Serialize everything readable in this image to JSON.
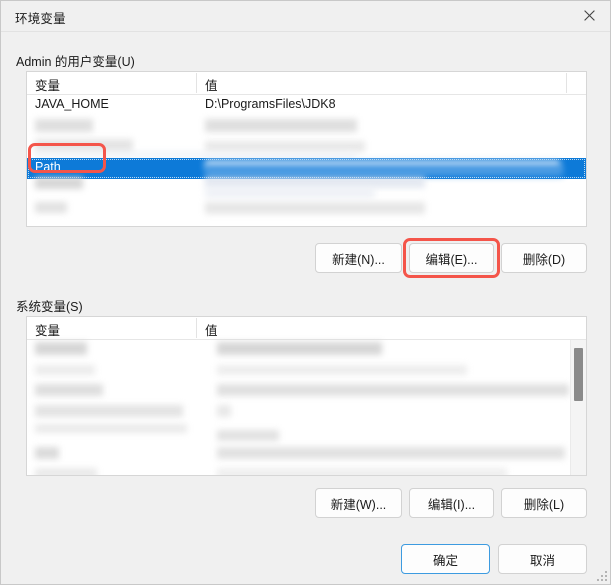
{
  "window": {
    "title": "环境变量",
    "close_icon": "close-icon"
  },
  "user_section": {
    "label": "Admin 的用户变量(U)",
    "columns": [
      "变量",
      "值"
    ],
    "rows": [
      {
        "name": "JAVA_HOME",
        "value": "D:\\ProgramsFiles\\JDK8",
        "redacted": false,
        "selected": false
      },
      {
        "name": "",
        "value": "",
        "redacted": true,
        "selected": false
      },
      {
        "name": "",
        "value": "",
        "redacted": true,
        "selected": false
      },
      {
        "name": "Path",
        "value": "",
        "redacted": false,
        "selected": true
      },
      {
        "name": "",
        "value": "",
        "redacted": true,
        "selected": false
      },
      {
        "name": "",
        "value": "",
        "redacted": true,
        "selected": false
      }
    ],
    "buttons": {
      "new": "新建(N)...",
      "edit": "编辑(E)...",
      "delete": "删除(D)"
    }
  },
  "system_section": {
    "label": "系统变量(S)",
    "columns": [
      "变量",
      "值"
    ],
    "rows": [
      {
        "name": "",
        "value": "",
        "redacted": true
      },
      {
        "name": "",
        "value": "",
        "redacted": true
      },
      {
        "name": "",
        "value": "",
        "redacted": true
      },
      {
        "name": "",
        "value": "",
        "redacted": true
      },
      {
        "name": "",
        "value": "",
        "redacted": true
      },
      {
        "name": "",
        "value": "",
        "redacted": true
      },
      {
        "name": "",
        "value": "",
        "redacted": true
      }
    ],
    "buttons": {
      "new": "新建(W)...",
      "edit": "编辑(I)...",
      "delete": "删除(L)"
    }
  },
  "footer": {
    "ok": "确定",
    "cancel": "取消"
  },
  "annotations": {
    "color": "#f4554a",
    "items": [
      "path-row-highlight",
      "edit-button-highlight"
    ]
  },
  "colors": {
    "selection_blue": "#0d7ad8",
    "default_button_border": "#3d9be0",
    "dialog_background": "#f0f0f0"
  }
}
